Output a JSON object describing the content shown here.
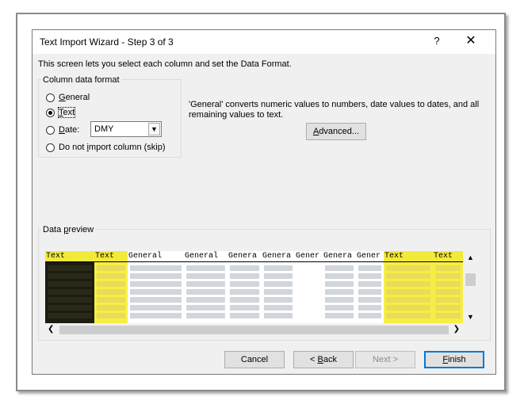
{
  "dialog": {
    "title": "Text Import Wizard - Step 3 of 3",
    "help_label": "?",
    "close_label": "✕",
    "description": "This screen lets you select each column and set the Data Format."
  },
  "format_group": {
    "label": "Column data format",
    "options": [
      {
        "label": "General",
        "mnemonic_char": "G",
        "rest": "eneral",
        "checked": false
      },
      {
        "label": "Text",
        "mnemonic_char": "T",
        "rest": "ext",
        "checked": true
      },
      {
        "label": "Date:",
        "mnemonic_char": "D",
        "rest": "ate:",
        "checked": false
      },
      {
        "label": "Do not import column (skip)",
        "checked": false
      }
    ],
    "skip_prefix": "Do not ",
    "skip_mnemonic": "i",
    "skip_rest": "mport column (skip)",
    "date_select_value": "DMY"
  },
  "info_text": "'General' converts numeric values to numbers, date values to dates, and all remaining values to text.",
  "advanced_button": {
    "prefix": "",
    "mnemonic": "A",
    "rest": "dvanced..."
  },
  "preview": {
    "label_prefix": "Data ",
    "label_mnemonic": "p",
    "label_rest": "review",
    "columns": [
      {
        "header": "Text",
        "selected": true
      },
      {
        "header": "Text",
        "selected": true
      },
      {
        "header": "General",
        "selected": false
      },
      {
        "header": "General",
        "selected": false
      },
      {
        "header": "Genera",
        "selected": false
      },
      {
        "header": "Genera",
        "selected": false
      },
      {
        "header": "Gener",
        "selected": false
      },
      {
        "header": "Genera",
        "selected": false
      },
      {
        "header": "Gener",
        "selected": false
      },
      {
        "header": "Text",
        "selected": true
      },
      {
        "header": "Text",
        "selected": true
      }
    ]
  },
  "buttons": {
    "cancel": "Cancel",
    "back_prefix": "< ",
    "back_mnemonic": "B",
    "back_rest": "ack",
    "next": "Next >",
    "finish_mnemonic": "F",
    "finish_rest": "inish"
  },
  "colors": {
    "selected_header": "#f2ea39",
    "selected_cell": "#f5ee45",
    "dark_cell": "#2b2b1a",
    "default_button_border": "#0078d7"
  }
}
